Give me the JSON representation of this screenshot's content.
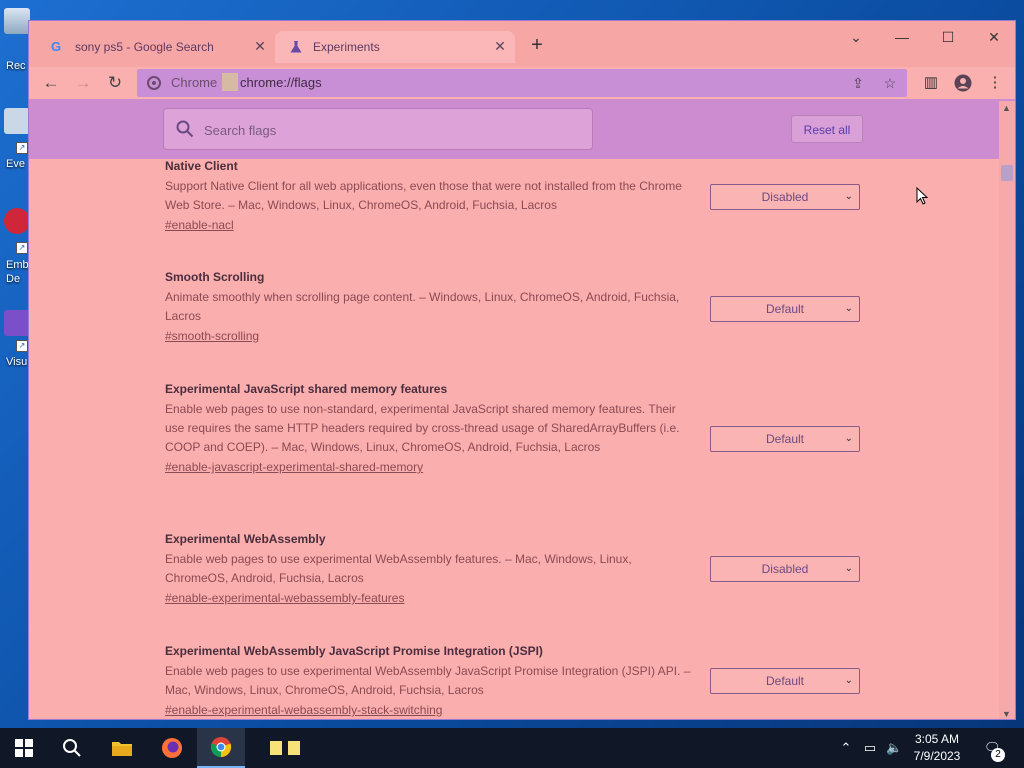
{
  "desktop": {
    "icons": [
      {
        "label": "Rec",
        "name": "recycle-bin"
      },
      {
        "label": "Eve",
        "name": "event-viewer"
      },
      {
        "label": "Emb\nDe",
        "name": "embarcadero"
      },
      {
        "label": "Visu",
        "name": "visual-studio"
      }
    ]
  },
  "browser": {
    "tabs": [
      {
        "title": "sony ps5 - Google Search",
        "active": false
      },
      {
        "title": "Experiments",
        "active": true
      }
    ],
    "new_tab": "+",
    "omnibox": {
      "site_chip": "Chrome",
      "url": "chrome://flags"
    }
  },
  "flags_page": {
    "search_placeholder": "Search flags",
    "reset_all_label": "Reset all",
    "flags": [
      {
        "title": "Native Client",
        "description": "Support Native Client for all web applications, even those that were not installed from the Chrome Web Store. – Mac, Windows, Linux, ChromeOS, Android, Fuchsia, Lacros",
        "link": "#enable-nacl",
        "value": "Disabled"
      },
      {
        "title": "Smooth Scrolling",
        "description": "Animate smoothly when scrolling page content. – Windows, Linux, ChromeOS, Android, Fuchsia, Lacros",
        "link": "#smooth-scrolling",
        "value": "Default"
      },
      {
        "title": "Experimental JavaScript shared memory features",
        "description": "Enable web pages to use non-standard, experimental JavaScript shared memory features. Their use requires the same HTTP headers required by cross-thread usage of SharedArrayBuffers (i.e. COOP and COEP). – Mac, Windows, Linux, ChromeOS, Android, Fuchsia, Lacros",
        "link": "#enable-javascript-experimental-shared-memory",
        "value": "Default"
      },
      {
        "title": "Experimental WebAssembly",
        "description": "Enable web pages to use experimental WebAssembly features. – Mac, Windows, Linux, ChromeOS, Android, Fuchsia, Lacros",
        "link": "#enable-experimental-webassembly-features",
        "value": "Disabled"
      },
      {
        "title": "Experimental WebAssembly JavaScript Promise Integration (JSPI)",
        "description": "Enable web pages to use experimental WebAssembly JavaScript Promise Integration (JSPI) API. – Mac, Windows, Linux, ChromeOS, Android, Fuchsia, Lacros",
        "link": "#enable-experimental-webassembly-stack-switching",
        "value": "Default"
      }
    ]
  },
  "taskbar": {
    "time": "3:05 AM",
    "date": "7/9/2023",
    "notification_count": "2"
  },
  "colors": {
    "window_bg": "#fbaeae",
    "header_purple": "#cd8ccf",
    "link_red": "#8b4b52",
    "select_text": "#6a4a82"
  }
}
